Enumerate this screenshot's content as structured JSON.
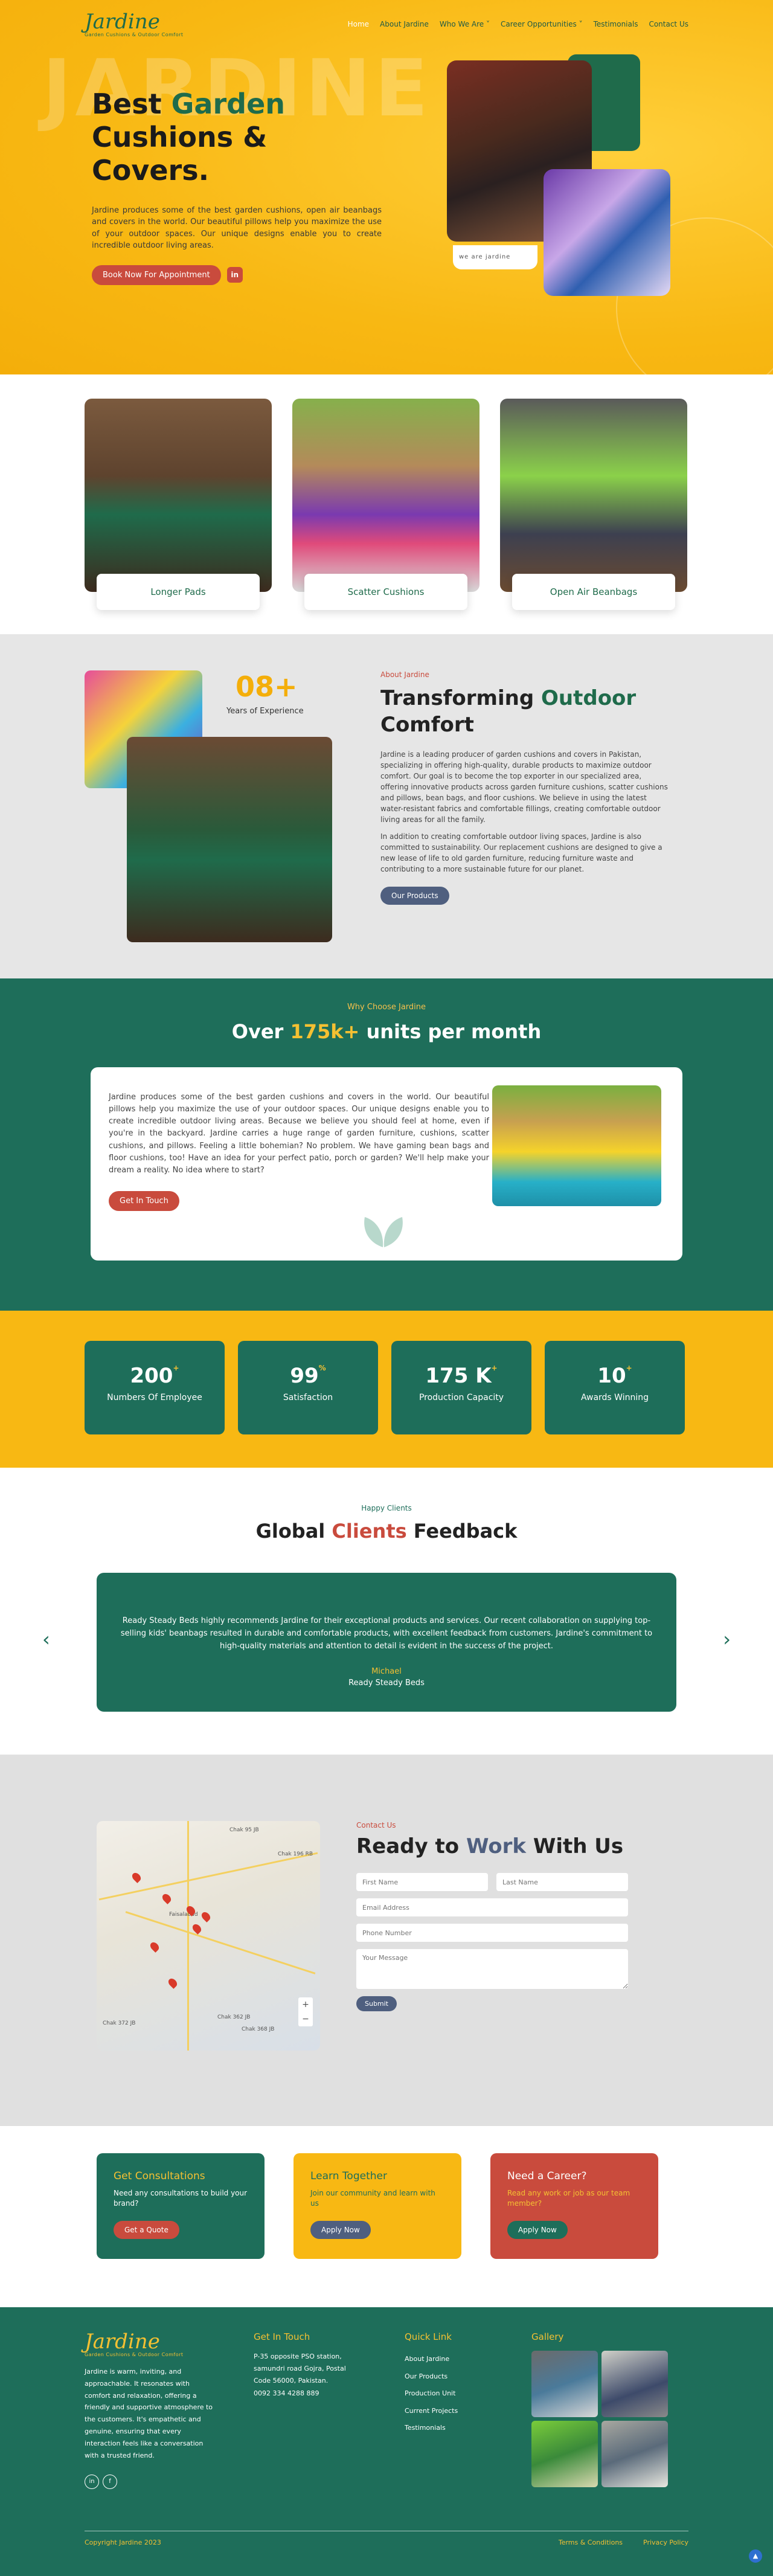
{
  "nav": {
    "logo_word": "Jardine",
    "logo_tag": "Garden Cushions & Outdoor Comfort",
    "items": [
      "Home",
      "About Jardine",
      "Who We Are ˅",
      "Career Opportunities ˅",
      "Testimonials",
      "Contact Us"
    ]
  },
  "hero": {
    "bg_word": "JARDINE",
    "title_a": "Best ",
    "title_b": "Garden",
    "title_c": "Cushions & Covers.",
    "desc": "Jardine produces some of the best garden cushions, open air beanbags and covers in the world. Our beautiful pillows help you maximize the use of your outdoor spaces. Our unique designs enable you to create incredible outdoor living areas.",
    "btn": "Book Now For Appointment",
    "weare": "we are jardine"
  },
  "products": [
    {
      "label": "Longer Pads"
    },
    {
      "label": "Scatter Cushions"
    },
    {
      "label": "Open Air Beanbags"
    }
  ],
  "about": {
    "num": "08+",
    "exp": "Years of Experience",
    "eyebrow": "About Jardine",
    "title_a": "Transforming ",
    "title_b": "Outdoor",
    "title_c": "Comfort",
    "p1": "Jardine is a leading producer of garden cushions and covers in Pakistan, specializing in offering high-quality, durable products to maximize outdoor comfort. Our goal is to become the top exporter in our specialized area, offering innovative products across garden furniture cushions, scatter cushions and pillows, bean bags, and floor cushions. We believe in using the latest water-resistant fabrics and comfortable fillings, creating comfortable outdoor living areas for all the family.",
    "p2": "In addition to creating comfortable outdoor living spaces, Jardine is also committed to sustainability. Our replacement cushions are designed to give a new lease of life to old garden furniture, reducing furniture waste and contributing to a more sustainable future for our planet.",
    "btn": "Our Products"
  },
  "why": {
    "eyebrow": "Why Choose Jardine",
    "title_a": "Over ",
    "title_b": "175k+",
    "title_c": " units per month",
    "text": "Jardine produces some of the best garden cushions and covers in the world. Our beautiful pillows help you maximize the use of your outdoor spaces. Our unique designs enable you to create incredible outdoor living areas. Because we believe you should feel at home, even if you're in the backyard. Jardine carries a huge range of garden furniture, cushions, scatter cushions, and pillows. Feeling a little bohemian? No problem. We have gaming bean bags and floor cushions, too! Have an idea for your perfect patio, porch or garden? We'll help make your dream a reality. No idea where to start?",
    "btn": "Get In Touch"
  },
  "stats": [
    {
      "num": "200",
      "sup": "+",
      "label": "Numbers Of Employee"
    },
    {
      "num": "99",
      "sup": "%",
      "label": "Satisfaction"
    },
    {
      "num": "175 K",
      "sup": "+",
      "label": "Production Capacity"
    },
    {
      "num": "10",
      "sup": "+",
      "label": "Awards Winning"
    }
  ],
  "testimonials": {
    "eyebrow": "Happy Clients",
    "title_a": "Global ",
    "title_b": "Clients",
    "title_c": " Feedback",
    "text": "Ready Steady Beds highly recommends Jardine for their exceptional products and services. Our recent collaboration on supplying top-selling kids' beanbags resulted in durable and comfortable products, with excellent feedback from customers. Jardine's commitment to high-quality materials and attention to detail is evident in the success of the project.",
    "name": "Michael",
    "company": "Ready Steady Beds",
    "prev": "‹",
    "next": "›"
  },
  "contact": {
    "eyebrow": "Contact Us",
    "title_a": "Ready to ",
    "title_b": "Work",
    "title_c": " With Us",
    "first_name": "First Name",
    "last_name": "Last Name",
    "email": "Email Address",
    "phone": "Phone Number",
    "message": "Your Message",
    "submit": "Submit",
    "map_labels": [
      "Chak 95 JB",
      "Chak 196 RB",
      "Chak 362 JB",
      "Chak 368 JB",
      "Chak 372 JB",
      "Faisalabad"
    ]
  },
  "cta": [
    {
      "title": "Get Consultations",
      "text": "Need any consultations to build your brand?",
      "btn": "Get a Quote"
    },
    {
      "title": "Learn Together",
      "text": "Join our community and learn with us",
      "btn": "Apply Now"
    },
    {
      "title": "Need a Career?",
      "text": "Read any work or job as our team member?",
      "btn": "Apply Now"
    }
  ],
  "footer": {
    "about": "Jardine is warm, inviting, and approachable. It resonates with comfort and relaxation, offering a friendly and supportive atmosphere to the customers. It's empathetic and genuine, ensuring that every interaction feels like a conversation with a trusted friend.",
    "touch_h": "Get In Touch",
    "address": "P-35 opposite PSO station, samundri road Gojra, Postal Code 56000, Pakistan.",
    "phone": "0092 334 4288 889",
    "quick_h": "Quick Link",
    "links": [
      "About Jardine",
      "Our Products",
      "Production Unit",
      "Current Projects",
      "Testimonials"
    ],
    "gallery_h": "Gallery",
    "copyright": "Copyright Jardine 2023",
    "terms": "Terms & Conditions",
    "privacy": "Privacy Policy"
  }
}
